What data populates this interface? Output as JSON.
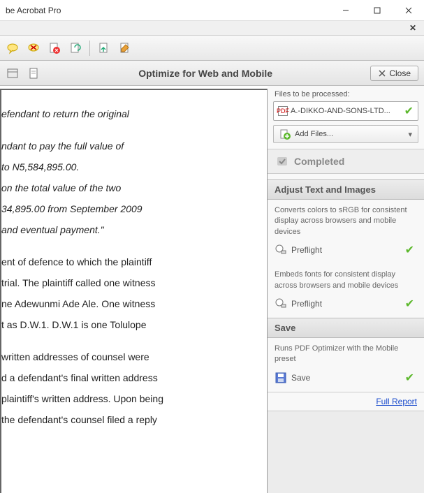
{
  "titlebar": {
    "title": "be Acrobat Pro"
  },
  "optimize": {
    "title": "Optimize for Web and Mobile",
    "close": "Close"
  },
  "side": {
    "files_label": "Files to be processed:",
    "file_name": "A.-DIKKO-AND-SONS-LTD...",
    "add_files": "Add Files...",
    "completed": "Completed",
    "adjust_hdr": "Adjust Text and Images",
    "desc1": "Converts colors to sRGB for consistent display across browsers and mobile devices",
    "preflight1": "Preflight",
    "desc2": "Embeds fonts for consistent display across browsers and mobile devices",
    "preflight2": "Preflight",
    "save_hdr": "Save",
    "save_desc": "Runs PDF Optimizer with the Mobile preset",
    "save_btn": "Save",
    "full_report": "Full Report"
  },
  "doc": {
    "p1": "efendant to return the original",
    "p2": "ndant to pay the full value of",
    "p3": "to N5,584,895.00.",
    "p4": "on the total value of the two",
    "p5": "34,895.00 from September 2009",
    "p6": "and eventual payment.\"",
    "p7": "ent of defence to which the plaintiff",
    "p8": "trial. The plaintiff called one witness",
    "p9": "ne Adewunmi Ade Ale. One witness",
    "p10": "t as D.W.1. D.W.1 is one Tolulope",
    "p11": "written addresses of counsel were",
    "p12": "d a defendant's final written address",
    "p13": "plaintiff's written address. Upon being",
    "p14": "the defendant's counsel filed a reply"
  }
}
